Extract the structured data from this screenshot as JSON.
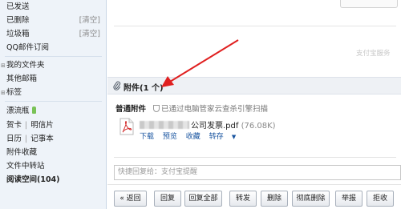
{
  "sidebar": {
    "sent": "已发送",
    "deleted": "已删除",
    "deleted_action": "[清空]",
    "trash": "垃圾箱",
    "trash_action": "[清空]",
    "qq_subscriptions": "QQ邮件订阅",
    "my_folders": "我的文件夹",
    "other_mailboxes": "其他邮箱",
    "tags": "标签",
    "drift_bottle": "漂流瓶",
    "greeting_card": "贺卡",
    "postcard": "明信片",
    "calendar": "日历",
    "notepad": "记事本",
    "attachment_favorites": "附件收藏",
    "file_transfer": "文件中转站",
    "reading_space": "阅读空间(104)"
  },
  "main": {
    "faint_sender_text": "支付宝服务",
    "attachment_header": "附件(1 个)",
    "attachment_type": "普通附件",
    "scan_status": "已通过电脑管家云查杀引擎扫描",
    "file_name": "公司发票.pdf",
    "file_size": "(76.08K)",
    "file_actions": {
      "download": "下载",
      "preview": "预览",
      "favorite": "收藏",
      "forward": "转存"
    },
    "quick_reply_placeholder": "快捷回复给：支付宝提醒"
  },
  "toolbar": {
    "back": "« 返回",
    "reply": "回复",
    "reply_all": "回复全部",
    "forward": "转发",
    "delete": "删除",
    "delete_permanently": "彻底删除",
    "report": "举报",
    "reject": "拒收"
  },
  "colors": {
    "sidebar_bg": "#eef3f9",
    "link_blue": "#1a55a0",
    "annotation_arrow": "#e02020",
    "attachment_header_bg": "#eef1f5"
  }
}
